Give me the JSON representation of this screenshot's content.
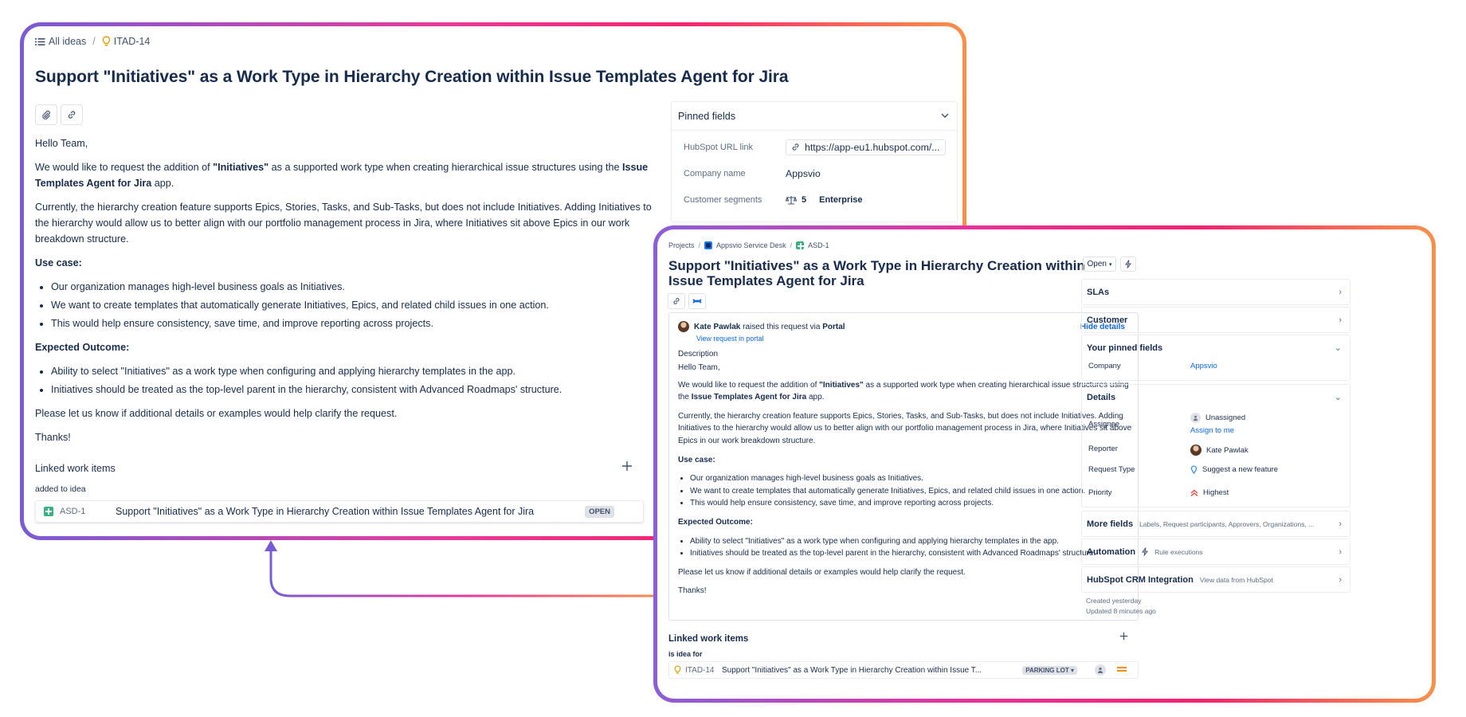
{
  "left": {
    "breadcrumb": {
      "all_ideas": "All ideas",
      "key": "ITAD-14"
    },
    "title": "Support \"Initiatives\" as a Work Type in Hierarchy Creation within Issue Templates Agent for Jira",
    "description": {
      "greeting": "Hello Team,",
      "p1_a": "We would like to request the addition of ",
      "p1_b": "\"Initiatives\"",
      "p1_c": " as a supported work type when creating hierarchical issue structures using the ",
      "p1_d": "Issue Templates Agent for Jira",
      "p1_e": " app.",
      "p2": "Currently, the hierarchy creation feature supports Epics, Stories, Tasks, and Sub-Tasks, but does not include Initiatives. Adding Initiatives to the hierarchy would allow us to better align with our portfolio management process in Jira, where Initiatives sit above Epics in our work breakdown structure.",
      "usecase_title": "Use case:",
      "usecase": [
        "Our organization manages high-level business goals as Initiatives.",
        "We want to create templates that automatically generate Initiatives, Epics, and related child issues in one action.",
        "This would help ensure consistency, save time, and improve reporting across projects."
      ],
      "outcome_title": "Expected Outcome:",
      "outcome": [
        "Ability to select \"Initiatives\" as a work type when configuring and applying hierarchy templates in the app.",
        "Initiatives should be treated as the top-level parent in the hierarchy, consistent with Advanced Roadmaps' structure."
      ],
      "closing": "Please let us know if additional details or examples would help clarify the request.",
      "thanks": "Thanks!"
    },
    "linked": {
      "title": "Linked work items",
      "relation": "added to idea",
      "item_key": "ASD-1",
      "item_summary": "Support \"Initiatives\" as a Work Type in Hierarchy Creation within Issue Templates Agent for Jira",
      "item_status": "OPEN"
    },
    "pinned": {
      "title": "Pinned fields",
      "url_label": "HubSpot URL link",
      "url_value": "https://app-eu1.hubspot.com/...",
      "company_label": "Company name",
      "company_value": "Appsvio",
      "segments_label": "Customer segments",
      "segments_count": "5",
      "segments_value": "Enterprise"
    }
  },
  "right": {
    "breadcrumb": {
      "projects": "Projects",
      "project": "Appsvio Service Desk",
      "key": "ASD-1"
    },
    "title": "Support \"Initiatives\" as a Work Type in Hierarchy Creation within Issue Templates Agent for Jira",
    "reporter_name": "Kate Pawlak",
    "raised_text": " raised this request via ",
    "channel": "Portal",
    "view_portal": "View request in portal",
    "hide_details": "Hide details",
    "desc_label": "Description",
    "linked": {
      "title": "Linked work items",
      "relation": "is idea for",
      "item_key": "ITAD-14",
      "item_summary": "Support \"Initiatives\" as a Work Type in Hierarchy Creation within Issue T...",
      "item_status": "PARKING LOT"
    },
    "status": "Open",
    "sections": {
      "slas": "SLAs",
      "customer": "Customer",
      "pinned": "Your pinned fields",
      "company_label": "Company",
      "company_value": "Appsvio",
      "details": "Details",
      "assignee_label": "Assignee",
      "assignee_value": "Unassigned",
      "assign_me": "Assign to me",
      "reporter_label": "Reporter",
      "reporter_value": "Kate Pawlak",
      "reqtype_label": "Request Type",
      "reqtype_value": "Suggest a new feature",
      "priority_label": "Priority",
      "priority_value": "Highest",
      "more_fields": "More fields",
      "more_fields_sub": "Labels, Request participants, Approvers, Organizations, ...",
      "automation": "Automation",
      "automation_sub": "Rule executions",
      "hubspot": "HubSpot CRM Integration",
      "hubspot_sub": "View data from HubSpot",
      "created": "Created yesterday",
      "updated": "Updated 8 minutes ago"
    }
  },
  "colors": {
    "accent": "#0c66e4",
    "gradient_start": "#7a5bd6",
    "gradient_mid": "#f2266f",
    "gradient_end": "#f8904a"
  }
}
